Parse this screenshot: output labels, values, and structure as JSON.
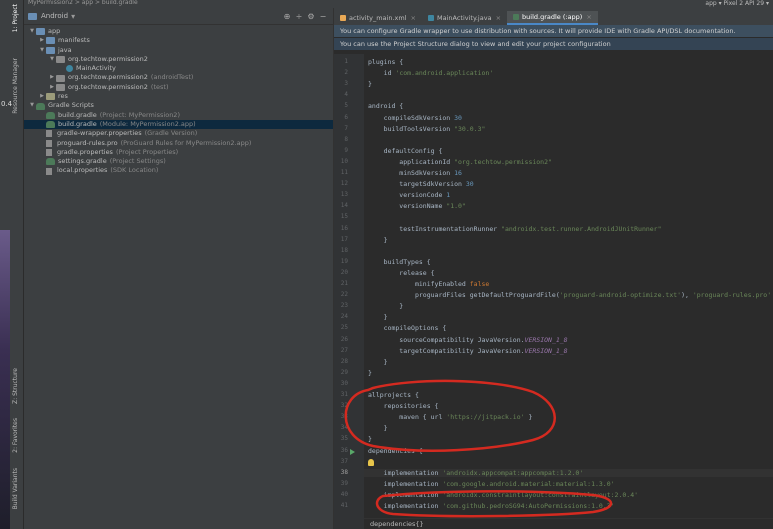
{
  "window": {
    "title": "MyPermission2 > app > build.gradle"
  },
  "tool_strip": {
    "tabs": [
      "1: Project",
      "Resource Manager",
      "Z: Structure",
      "2: Favorites",
      "Build Variants"
    ],
    "side_number": "0.4"
  },
  "project_panel": {
    "view_selector": "Android",
    "header_icons": [
      "target-icon",
      "collapse-icon",
      "gear-icon",
      "minimize-icon"
    ],
    "tree": [
      {
        "label": "app",
        "indent": 0,
        "arrow": "▼",
        "icon": "folder-blue"
      },
      {
        "label": "manifests",
        "indent": 1,
        "arrow": "▶",
        "icon": "folder-blue"
      },
      {
        "label": "java",
        "indent": 1,
        "arrow": "▼",
        "icon": "folder-blue"
      },
      {
        "label": "org.techtow.permission2",
        "indent": 2,
        "arrow": "▼",
        "icon": "folder"
      },
      {
        "label": "MainActivity",
        "indent": 3,
        "arrow": "",
        "icon": "class"
      },
      {
        "label": "org.techtow.permission2",
        "suffix": "(androidTest)",
        "indent": 2,
        "arrow": "▶",
        "icon": "folder"
      },
      {
        "label": "org.techtow.permission2",
        "suffix": "(test)",
        "indent": 2,
        "arrow": "▶",
        "icon": "folder"
      },
      {
        "label": "res",
        "indent": 1,
        "arrow": "▶",
        "icon": "folder-res"
      },
      {
        "label": "Gradle Scripts",
        "indent": 0,
        "arrow": "▼",
        "icon": "elephant"
      },
      {
        "label": "build.gradle",
        "suffix": "(Project: MyPermission2)",
        "indent": 1,
        "arrow": "",
        "icon": "elephant"
      },
      {
        "label": "build.gradle",
        "suffix": "(Module: MyPermission2.app)",
        "indent": 1,
        "arrow": "",
        "icon": "elephant",
        "selected": true
      },
      {
        "label": "gradle-wrapper.properties",
        "suffix": "(Gradle Version)",
        "indent": 1,
        "arrow": "",
        "icon": "file"
      },
      {
        "label": "proguard-rules.pro",
        "suffix": "(ProGuard Rules for MyPermission2.app)",
        "indent": 1,
        "arrow": "",
        "icon": "file"
      },
      {
        "label": "gradle.properties",
        "suffix": "(Project Properties)",
        "indent": 1,
        "arrow": "",
        "icon": "file"
      },
      {
        "label": "settings.gradle",
        "suffix": "(Project Settings)",
        "indent": 1,
        "arrow": "",
        "icon": "elephant"
      },
      {
        "label": "local.properties",
        "suffix": "(SDK Location)",
        "indent": 1,
        "arrow": "",
        "icon": "file"
      }
    ]
  },
  "editor": {
    "run_config": "app ▾  Pixel 2 API 29 ▾",
    "tabs": [
      {
        "label": "activity_main.xml",
        "color": "#e8a855",
        "active": false
      },
      {
        "label": "MainActivity.java",
        "color": "#3e86a0",
        "active": false
      },
      {
        "label": "build.gradle (:app)",
        "color": "#4c7a59",
        "active": true
      }
    ],
    "banners": [
      "You can configure Gradle wrapper to use distribution with sources. It will provide IDE with Gradle API/DSL documentation.",
      "You can use the Project Structure dialog to view and edit your project configuration"
    ],
    "breadcrumb": "dependencies{}",
    "lines": [
      [
        [
          "p",
          "plugins {"
        ]
      ],
      [
        [
          "p",
          "    id "
        ],
        [
          "s",
          "'com.android.application'"
        ]
      ],
      [
        [
          "p",
          "}"
        ]
      ],
      [],
      [
        [
          "p",
          "android {"
        ]
      ],
      [
        [
          "p",
          "    compileSdkVersion "
        ],
        [
          "n",
          "30"
        ]
      ],
      [
        [
          "p",
          "    buildToolsVersion "
        ],
        [
          "s",
          "\"30.0.3\""
        ]
      ],
      [],
      [
        [
          "p",
          "    defaultConfig {"
        ]
      ],
      [
        [
          "p",
          "        applicationId "
        ],
        [
          "s",
          "\"org.techtow.permission2\""
        ]
      ],
      [
        [
          "p",
          "        minSdkVersion "
        ],
        [
          "n",
          "16"
        ]
      ],
      [
        [
          "p",
          "        targetSdkVersion "
        ],
        [
          "n",
          "30"
        ]
      ],
      [
        [
          "p",
          "        versionCode "
        ],
        [
          "n",
          "1"
        ]
      ],
      [
        [
          "p",
          "        versionName "
        ],
        [
          "s",
          "\"1.0\""
        ]
      ],
      [],
      [
        [
          "p",
          "        testInstrumentationRunner "
        ],
        [
          "s",
          "\"androidx.test.runner.AndroidJUnitRunner\""
        ]
      ],
      [
        [
          "p",
          "    }"
        ]
      ],
      [],
      [
        [
          "p",
          "    buildTypes {"
        ]
      ],
      [
        [
          "p",
          "        release {"
        ]
      ],
      [
        [
          "p",
          "            minifyEnabled "
        ],
        [
          "k",
          "false"
        ]
      ],
      [
        [
          "p",
          "            proguardFiles getDefaultProguardFile("
        ],
        [
          "s",
          "'proguard-android-optimize.txt'"
        ],
        [
          "p",
          "), "
        ],
        [
          "s",
          "'proguard-rules.pro'"
        ]
      ],
      [
        [
          "p",
          "        }"
        ]
      ],
      [
        [
          "p",
          "    }"
        ]
      ],
      [
        [
          "p",
          "    compileOptions {"
        ]
      ],
      [
        [
          "p",
          "        sourceCompatibility JavaVersion."
        ],
        [
          "f",
          "VERSION_1_8"
        ]
      ],
      [
        [
          "p",
          "        targetCompatibility JavaVersion."
        ],
        [
          "f",
          "VERSION_1_8"
        ]
      ],
      [
        [
          "p",
          "    }"
        ]
      ],
      [
        [
          "p",
          "}"
        ]
      ],
      [],
      [
        [
          "p",
          "allprojects {"
        ]
      ],
      [
        [
          "p",
          "    repositories {"
        ]
      ],
      [
        [
          "p",
          "        maven { url "
        ],
        [
          "s",
          "'https://jitpack.io'"
        ],
        [
          "p",
          " }"
        ]
      ],
      [
        [
          "p",
          "    }"
        ]
      ],
      [
        [
          "p",
          "}"
        ]
      ],
      [
        [
          "p",
          "dependencies {"
        ]
      ],
      [],
      [
        [
          "p",
          "    implementation "
        ],
        [
          "s",
          "'androidx.appcompat:appcompat:1.2.0'"
        ]
      ],
      [
        [
          "p",
          "    implementation "
        ],
        [
          "s",
          "'com.google.android.material:material:1.3.0'"
        ]
      ],
      [
        [
          "p",
          "    implementation "
        ],
        [
          "s",
          "'androidx.constraintlayout:constraintlayout:2.0.4'"
        ]
      ],
      [
        [
          "p",
          "    implementation "
        ],
        [
          "s",
          "'com.github.pedroSG94:AutoPermissions:1.0.3'"
        ]
      ]
    ],
    "current_line": 38,
    "colors": {
      "string": "#6a8759",
      "keyword": "#cc7832",
      "number": "#6897bb",
      "field": "#9876aa",
      "plain": "#a9b7c6",
      "annotation": "#d42a20"
    }
  }
}
